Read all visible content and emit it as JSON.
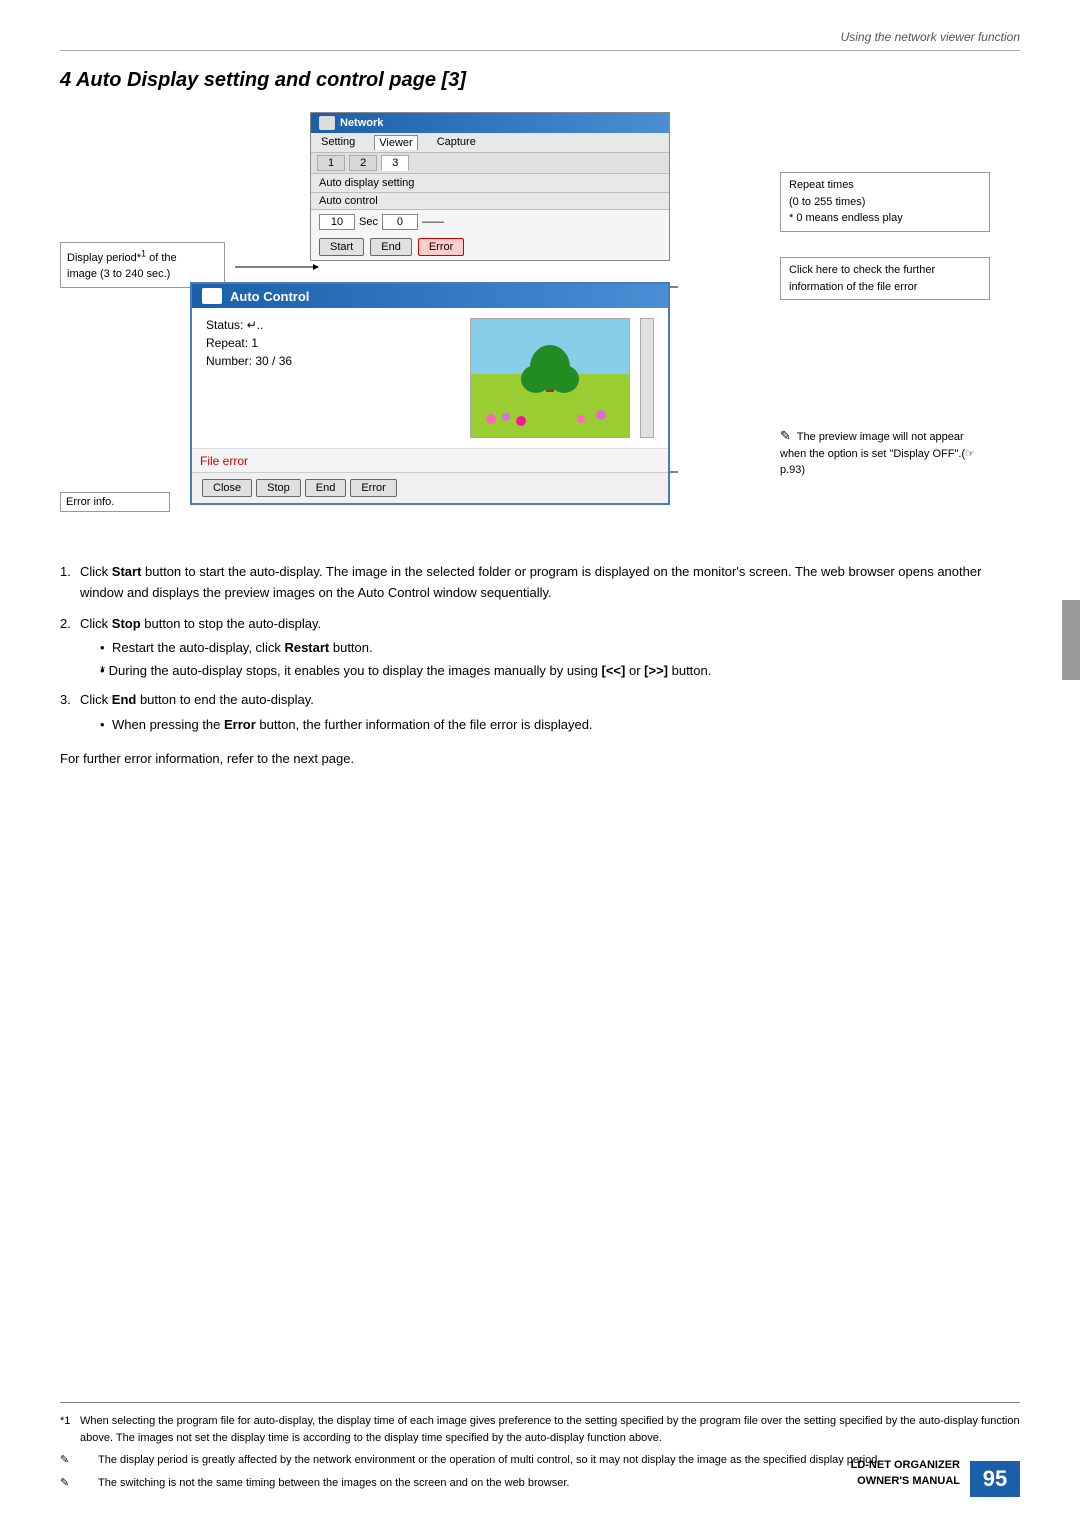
{
  "page": {
    "header": "Using the network viewer function",
    "section_number": "4",
    "section_title": "Auto Display setting and control page [3]"
  },
  "network_window": {
    "title": "Network",
    "menu_items": [
      "Setting",
      "Viewer",
      "Capture"
    ],
    "active_menu": "Viewer",
    "tabs": [
      "1",
      "2",
      "3"
    ],
    "active_tab": "3",
    "auto_display_section": "Auto display setting",
    "auto_control_section": "Auto control",
    "time_value": "10",
    "time_unit": "Sec",
    "repeat_value": "0",
    "buttons": {
      "start": "Start",
      "end": "End",
      "error": "Error"
    }
  },
  "auto_control_window": {
    "title": "Auto Control",
    "status_label": "Status:",
    "status_value": "⤳..",
    "repeat_label": "Repeat:",
    "repeat_value": "1",
    "number_label": "Number:",
    "number_value": "30 / 36",
    "file_error": "File error",
    "error_info_label": "Error info.",
    "buttons": {
      "close": "Close",
      "stop": "Stop",
      "end": "End",
      "error": "Error"
    }
  },
  "callouts": {
    "repeat_times": "Repeat times\n(0 to 255 times)\n* 0 means endless play",
    "click_here": "Click here to check the further information of the file error",
    "display_period": "Display period*1 of the\nimage (3 to 240 sec.)",
    "preview_note": "The preview image will not appear when the option is set \"Display OFF\".(☞ p.93)"
  },
  "instructions": [
    {
      "number": "1.",
      "text": "Click ",
      "bold_word": "Start",
      "rest": " button to start the auto-display. The image in the selected folder or program is displayed on the monitor's screen. The web browser opens another window and displays the preview images on the Auto Control window sequentially."
    },
    {
      "number": "2.",
      "text": "Click ",
      "bold_word": "Stop",
      "rest": " button to stop the auto-display.",
      "sub_bullets": [
        "Restart the auto-display, click Restart button.",
        "* During the auto-display stops, it enables you to display the images manually by using [<<] or [>>] button."
      ]
    },
    {
      "number": "3.",
      "text": "Click ",
      "bold_word": "End",
      "rest": " button to end the auto-display.",
      "sub_bullets": [
        "When pressing the Error button, the further information of the file error is displayed."
      ]
    }
  ],
  "further_error": "For further error information, refer to the next page.",
  "footer_notes": [
    {
      "marker": "*1",
      "text": "When selecting the program file for auto-display, the display time of each image gives preference to the setting specified by the program file over the setting specified by the auto-display function above. The images not set the display time is according to the display time specified by the auto-display function above."
    },
    {
      "marker": "✎",
      "text": "The display period is greatly affected by the network environment or the operation of multi control, so it may not display the image as the specified display period."
    },
    {
      "marker": "✎",
      "text": "The switching is not the same timing between the images on the screen and on the web browser."
    }
  ],
  "brand": {
    "line1": "LD-NET ORGANIZER",
    "line2": "OWNER'S MANUAL"
  },
  "page_number": "95"
}
